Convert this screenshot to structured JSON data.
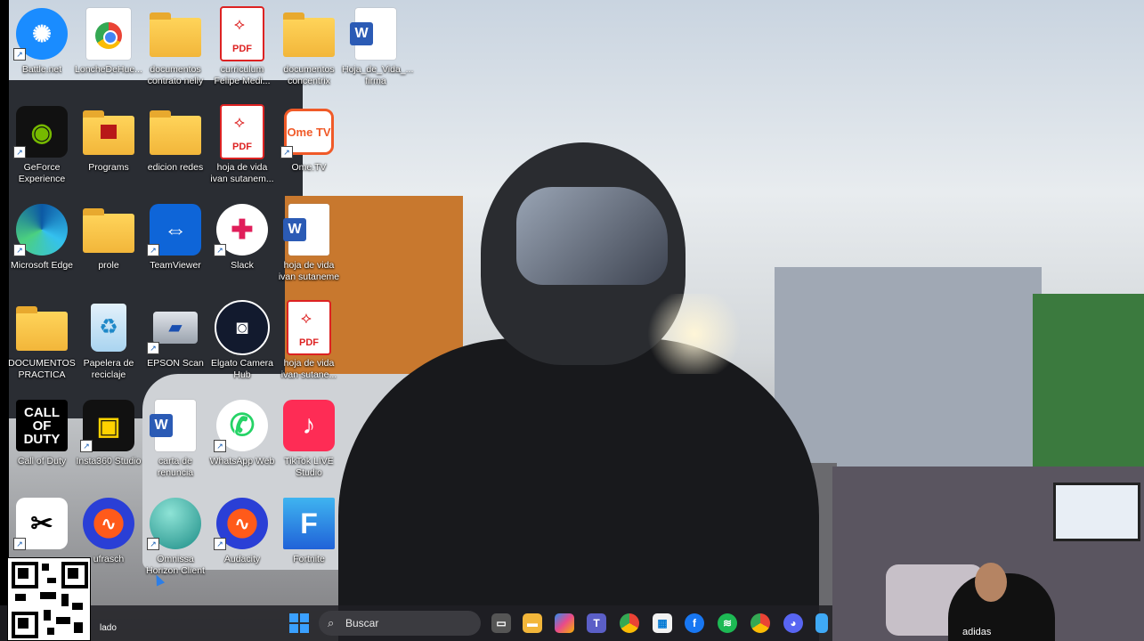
{
  "desktop": {
    "icons": [
      {
        "label": "Battle.net",
        "kind": "battlenet-icon"
      },
      {
        "label": "LoncheDeHue...",
        "kind": "chrome-icon"
      },
      {
        "label": "documentos contrato nelly",
        "kind": "folder-icon"
      },
      {
        "label": "curriculum Felipe Medi...",
        "kind": "pdf-icon"
      },
      {
        "label": "documentos concentrix",
        "kind": "folder-icon"
      },
      {
        "label": "Hoja_de_Vida_... firma",
        "kind": "word-icon"
      },
      {
        "label": "GeForce Experience",
        "kind": "nvidia-icon"
      },
      {
        "label": "Programs",
        "kind": "folder-icon"
      },
      {
        "label": "edicion redes",
        "kind": "folder-icon"
      },
      {
        "label": "hoja de vida ivan sutanem...",
        "kind": "pdf-icon"
      },
      {
        "label": "Ome.TV",
        "kind": "ometv-icon"
      },
      {
        "label": "Microsoft Edge",
        "kind": "edge-icon"
      },
      {
        "label": "prole",
        "kind": "folder-icon"
      },
      {
        "label": "TeamViewer",
        "kind": "teamviewer-icon"
      },
      {
        "label": "Slack",
        "kind": "slack-icon"
      },
      {
        "label": "hoja de vida ivan sutaneme",
        "kind": "word-icon"
      },
      {
        "label": "DOCUMENTOS PRACTICA",
        "kind": "folder-icon"
      },
      {
        "label": "Papelera de reciclaje",
        "kind": "recycle-bin-icon"
      },
      {
        "label": "EPSON Scan",
        "kind": "epson-scan-icon"
      },
      {
        "label": "Elgato Camera Hub",
        "kind": "elgato-icon"
      },
      {
        "label": "hoja de vida ivan sutane...",
        "kind": "pdf-icon"
      },
      {
        "label": "Call of Duty",
        "kind": "call-of-duty-icon"
      },
      {
        "label": "Insta360 Studio",
        "kind": "insta360-icon"
      },
      {
        "label": "carta de renuncia",
        "kind": "word-icon"
      },
      {
        "label": "WhatsApp Web",
        "kind": "whatsapp-icon"
      },
      {
        "label": "TikTok LIVE Studio",
        "kind": "tiktok-icon"
      },
      {
        "label": "",
        "kind": "capcut-icon"
      },
      {
        "label": "ufrasch",
        "kind": "audacity-icon"
      },
      {
        "label": "Omnissa Horizon Client",
        "kind": "horizon-icon"
      },
      {
        "label": "Audacity",
        "kind": "audacity-icon"
      },
      {
        "label": "Fortnite",
        "kind": "fortnite-icon"
      }
    ]
  },
  "icon_text": {
    "pdf": "PDF",
    "word": "W",
    "ometv": "Ome TV",
    "cod": "CALL OF DUTY",
    "fortnite": "F"
  },
  "taskbar": {
    "left_text": "lado",
    "search_placeholder": "Buscar",
    "apps": [
      "task-view-icon",
      "file-explorer-icon",
      "copilot-icon",
      "teams-icon",
      "chrome-icon",
      "store-icon",
      "facebook-icon",
      "spotify-icon",
      "chrome-alt-icon",
      "discord-icon",
      "app-icon"
    ]
  },
  "webcam": {
    "shirt_text": "adidas"
  }
}
